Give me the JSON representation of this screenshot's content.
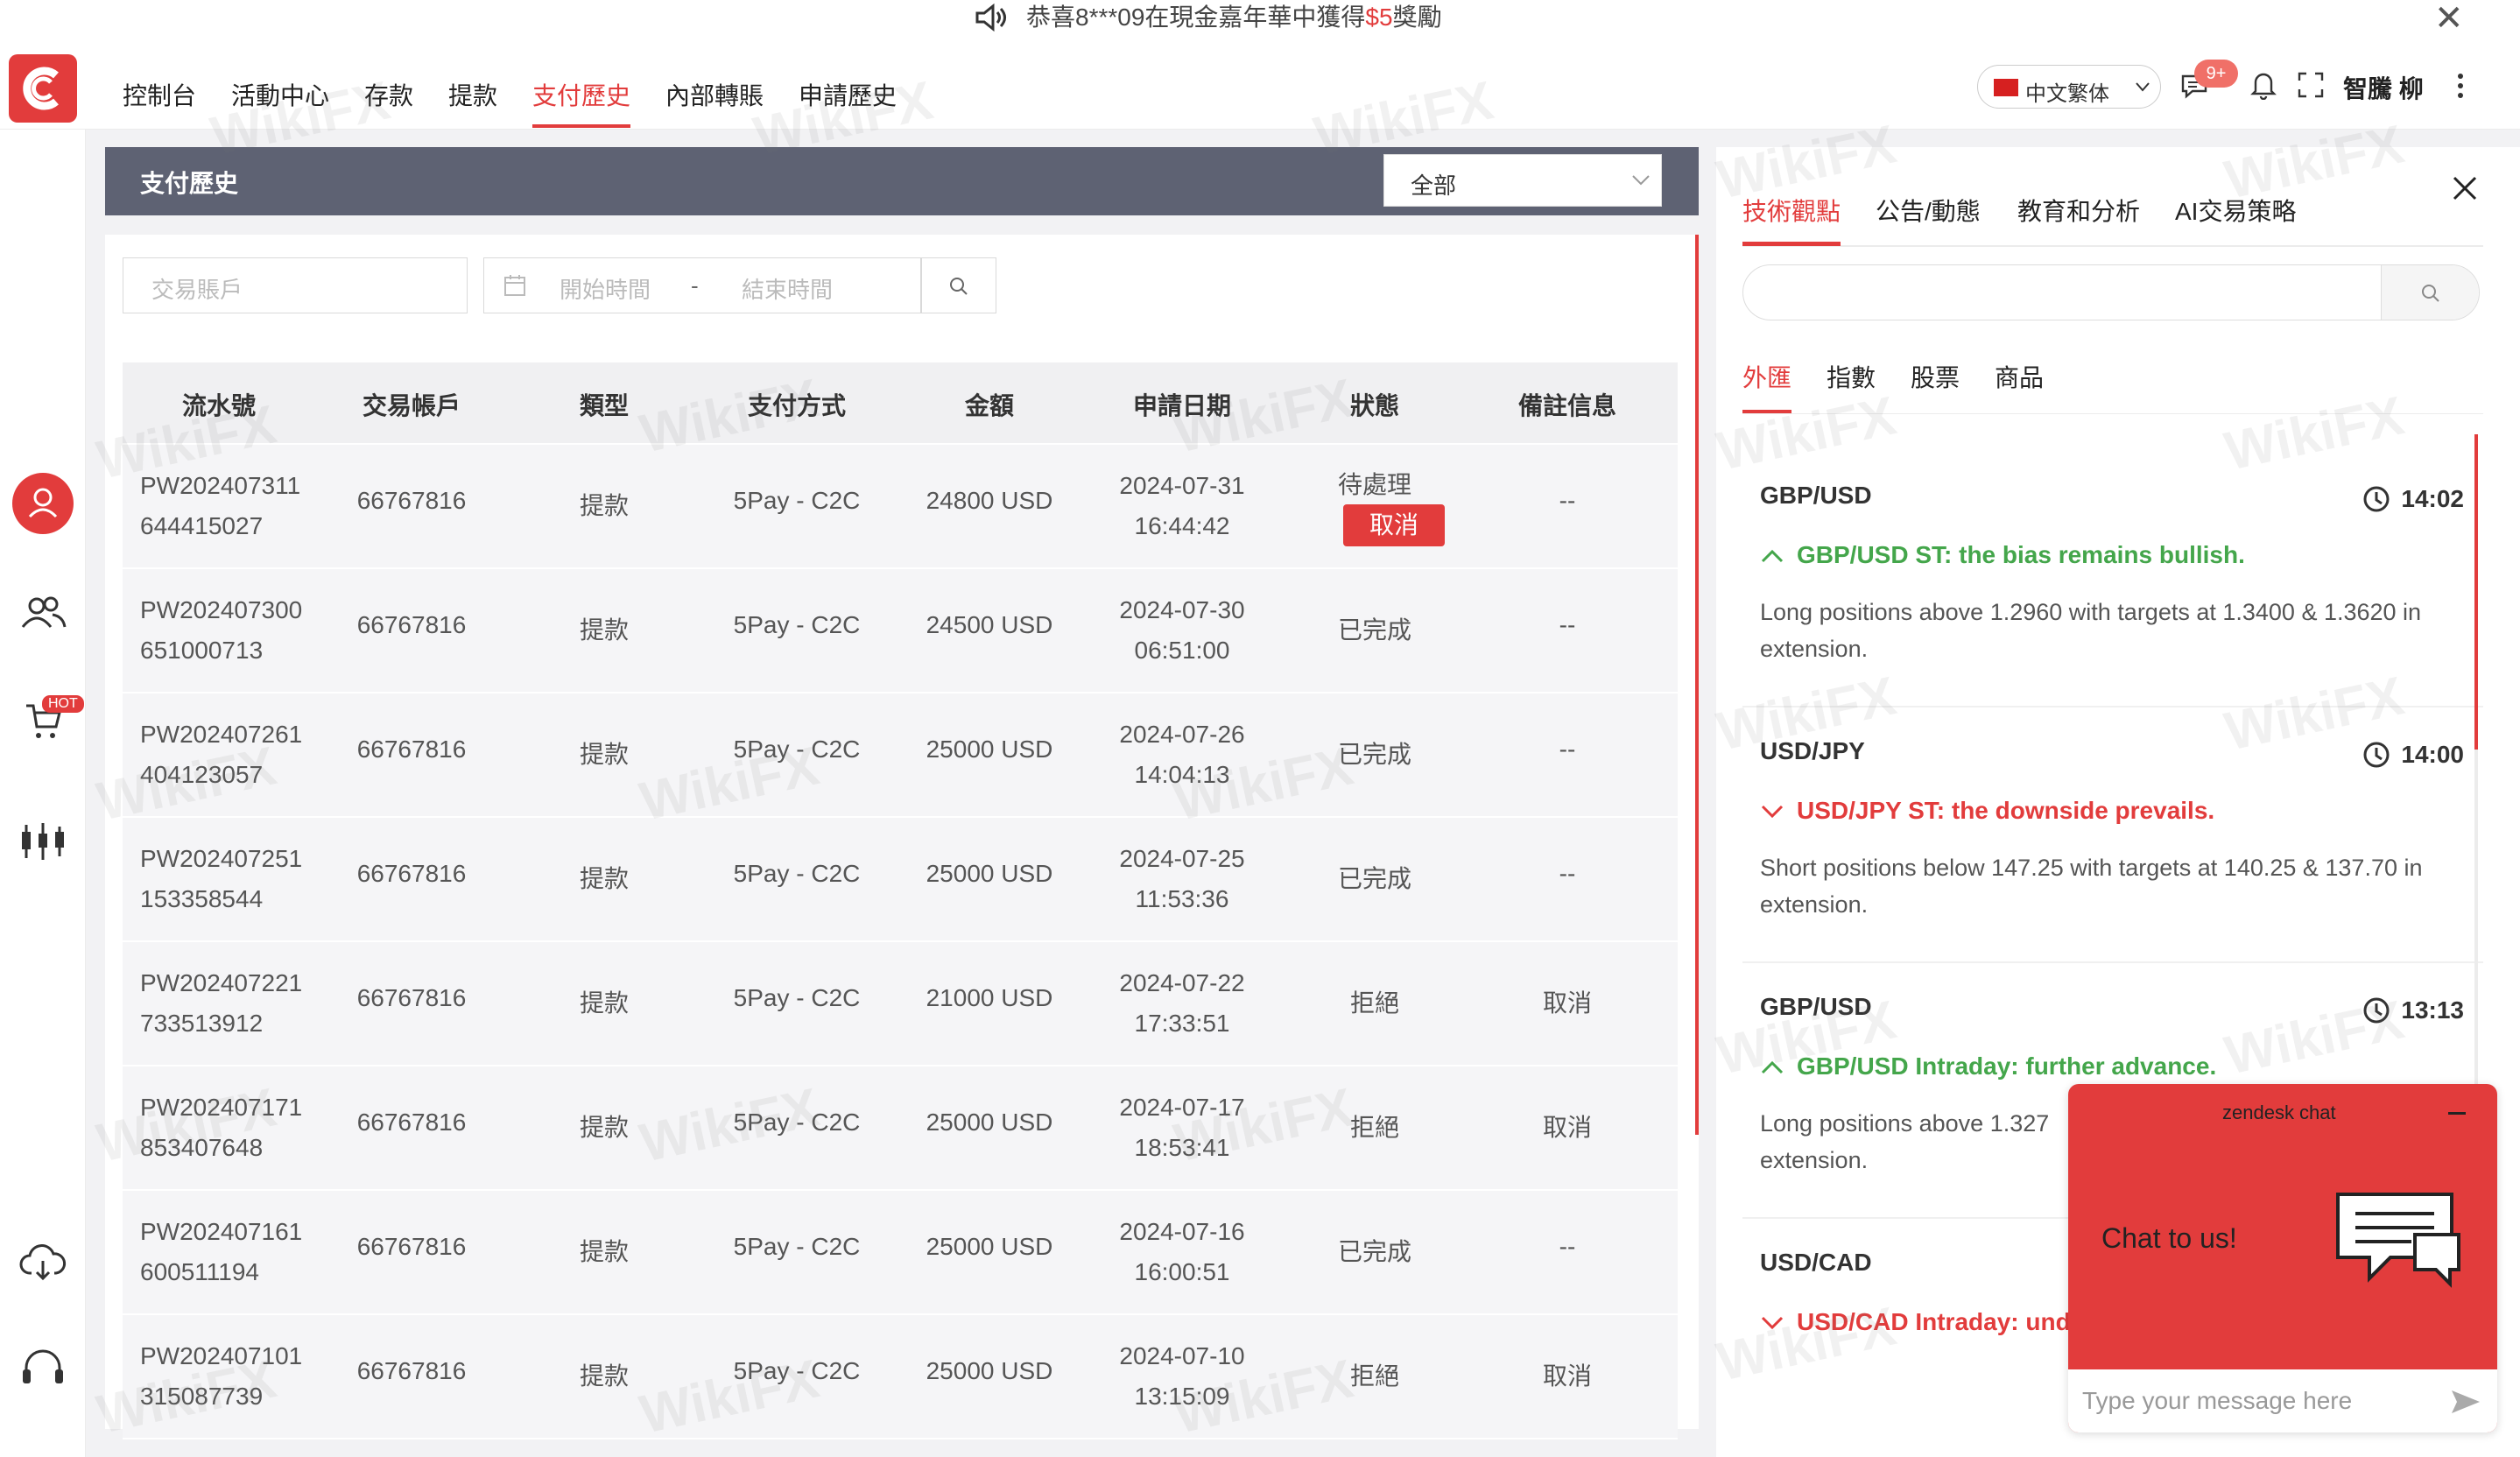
{
  "announcement": {
    "text_before": "恭喜8***09在現金嘉年華中獲得",
    "amount": "$5",
    "text_after": "獎勵"
  },
  "nav": {
    "items": [
      {
        "label": "控制台"
      },
      {
        "label": "活動中心"
      },
      {
        "label": "存款"
      },
      {
        "label": "提款"
      },
      {
        "label": "支付歷史",
        "active": true
      },
      {
        "label": "內部轉賬"
      },
      {
        "label": "申請歷史"
      }
    ]
  },
  "header": {
    "language": "中文繁体",
    "notification_count": "9+",
    "username": "智騰 柳"
  },
  "sidebar": {
    "hot_badge": "HOT"
  },
  "payment": {
    "title": "支付歷史",
    "filter_select": "全部",
    "account_placeholder": "交易賬戶",
    "start_placeholder": "開始時間",
    "range_sep": "-",
    "end_placeholder": "結束時間",
    "columns": [
      "流水號",
      "交易帳戶",
      "類型",
      "支付方式",
      "金額",
      "申請日期",
      "狀態",
      "備註信息"
    ],
    "rows": [
      {
        "serial_1": "PW202407311",
        "serial_2": "644415027",
        "account": "66767816",
        "type": "提款",
        "method": "5Pay - C2C",
        "amount": "24800 USD",
        "date": "2024-07-31",
        "time": "16:44:42",
        "status": "待處理",
        "action": "取消",
        "note": "--"
      },
      {
        "serial_1": "PW202407300",
        "serial_2": "651000713",
        "account": "66767816",
        "type": "提款",
        "method": "5Pay - C2C",
        "amount": "24500 USD",
        "date": "2024-07-30",
        "time": "06:51:00",
        "status": "已完成",
        "note": "--"
      },
      {
        "serial_1": "PW202407261",
        "serial_2": "404123057",
        "account": "66767816",
        "type": "提款",
        "method": "5Pay - C2C",
        "amount": "25000 USD",
        "date": "2024-07-26",
        "time": "14:04:13",
        "status": "已完成",
        "note": "--"
      },
      {
        "serial_1": "PW202407251",
        "serial_2": "153358544",
        "account": "66767816",
        "type": "提款",
        "method": "5Pay - C2C",
        "amount": "25000 USD",
        "date": "2024-07-25",
        "time": "11:53:36",
        "status": "已完成",
        "note": "--"
      },
      {
        "serial_1": "PW202407221",
        "serial_2": "733513912",
        "account": "66767816",
        "type": "提款",
        "method": "5Pay - C2C",
        "amount": "21000 USD",
        "date": "2024-07-22",
        "time": "17:33:51",
        "status": "拒絕",
        "note": "取消"
      },
      {
        "serial_1": "PW202407171",
        "serial_2": "853407648",
        "account": "66767816",
        "type": "提款",
        "method": "5Pay - C2C",
        "amount": "25000 USD",
        "date": "2024-07-17",
        "time": "18:53:41",
        "status": "拒絕",
        "note": "取消"
      },
      {
        "serial_1": "PW202407161",
        "serial_2": "600511194",
        "account": "66767816",
        "type": "提款",
        "method": "5Pay - C2C",
        "amount": "25000 USD",
        "date": "2024-07-16",
        "time": "16:00:51",
        "status": "已完成",
        "note": "--"
      },
      {
        "serial_1": "PW202407101",
        "serial_2": "315087739",
        "account": "66767816",
        "type": "提款",
        "method": "5Pay - C2C",
        "amount": "25000 USD",
        "date": "2024-07-10",
        "time": "13:15:09",
        "status": "拒絕",
        "note": "取消"
      }
    ]
  },
  "right_panel": {
    "tabs": [
      "技術觀點",
      "公告/動態",
      "教育和分析",
      "AI交易策略"
    ],
    "active_tab": "技術觀點",
    "subtabs": [
      "外匯",
      "指數",
      "股票",
      "商品"
    ],
    "active_subtab": "外匯",
    "news": [
      {
        "pair": "GBP/USD",
        "time": "14:02",
        "direction": "up",
        "headline": "GBP/USD ST: the bias remains bullish.",
        "body": "Long positions above 1.2960 with targets at 1.3400 & 1.3620 in extension."
      },
      {
        "pair": "USD/JPY",
        "time": "14:00",
        "direction": "down",
        "headline": "USD/JPY ST: the downside prevails.",
        "body": "Short positions below 147.25 with targets at 140.25 & 137.70 in extension."
      },
      {
        "pair": "GBP/USD",
        "time": "13:13",
        "direction": "up",
        "headline": "GBP/USD Intraday: further advance.",
        "body": "Long positions above 1.327",
        "body_2": "extension."
      },
      {
        "pair": "USD/CAD",
        "time": "",
        "direction": "down",
        "headline": "USD/CAD Intraday: und",
        "body": ""
      }
    ]
  },
  "zendesk": {
    "title": "zendesk chat",
    "greeting": "Chat to us!",
    "placeholder": "Type your message here"
  },
  "watermark": "WikiFX",
  "colors": {
    "accent": "#e23c3c",
    "title_bar": "#5e6273",
    "up": "#44a64b",
    "down": "#e23c3c"
  }
}
